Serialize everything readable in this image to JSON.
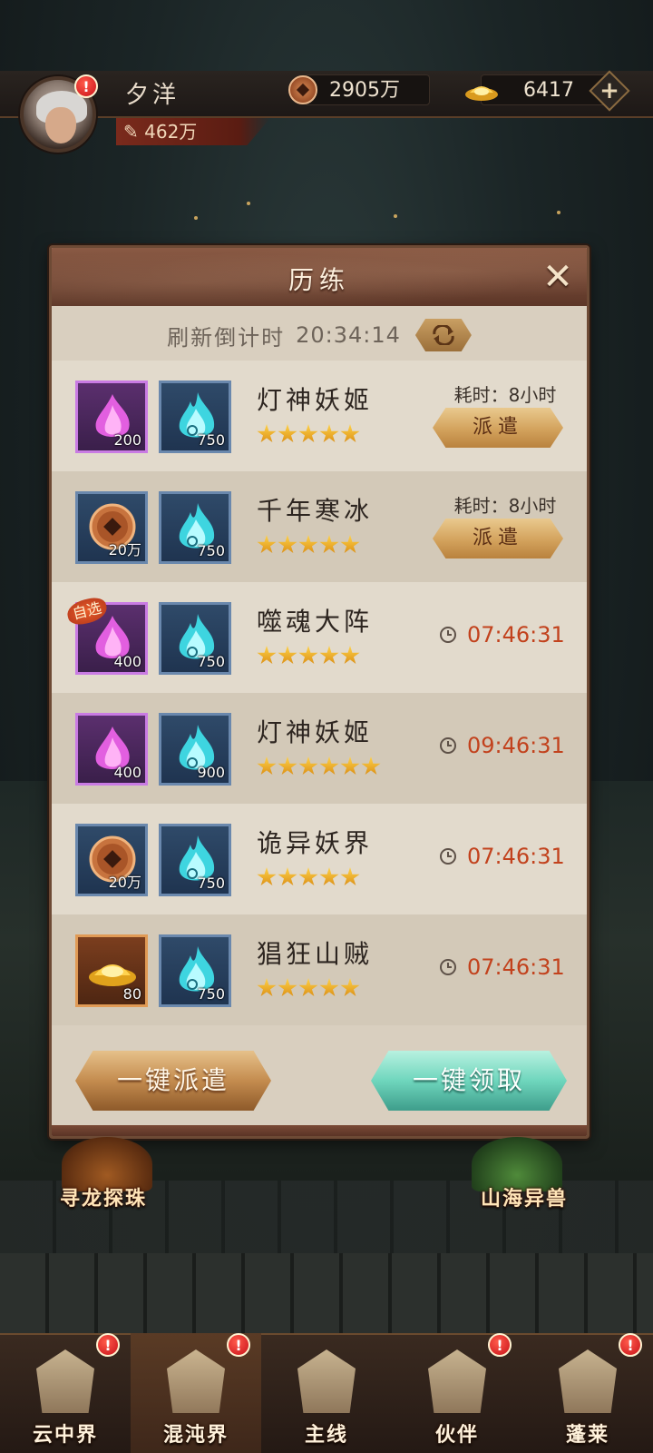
{
  "player": {
    "name": "夕洋",
    "power": "462万"
  },
  "resources": {
    "copper": "2905万",
    "gold": "6417"
  },
  "panel": {
    "title": "历练",
    "refresh_label": "刷新倒计时",
    "refresh_time": "20:34:14",
    "rows": [
      {
        "name": "灯神妖姬",
        "stars": 5,
        "item1": {
          "type": "purple-crystal",
          "qty": "200",
          "custom": false
        },
        "item2": {
          "type": "blue-flame",
          "qty": "750"
        },
        "duration": "耗时：8小时",
        "action": "派遣"
      },
      {
        "name": "千年寒冰",
        "stars": 5,
        "item1": {
          "type": "copper-coin",
          "qty": "20万",
          "custom": false
        },
        "item2": {
          "type": "blue-flame",
          "qty": "750"
        },
        "duration": "耗时：8小时",
        "action": "派遣"
      },
      {
        "name": "噬魂大阵",
        "stars": 5,
        "item1": {
          "type": "purple-crystal",
          "qty": "400",
          "custom": true
        },
        "item2": {
          "type": "blue-flame",
          "qty": "750"
        },
        "timer": "07:46:31"
      },
      {
        "name": "灯神妖姬",
        "stars": 6,
        "item1": {
          "type": "purple-crystal",
          "qty": "400",
          "custom": false
        },
        "item2": {
          "type": "blue-flame",
          "qty": "900"
        },
        "timer": "09:46:31"
      },
      {
        "name": "诡异妖界",
        "stars": 5,
        "item1": {
          "type": "copper-coin",
          "qty": "20万",
          "custom": false
        },
        "item2": {
          "type": "blue-flame",
          "qty": "750"
        },
        "timer": "07:46:31"
      },
      {
        "name": "猖狂山贼",
        "stars": 5,
        "item1": {
          "type": "gold-ingot",
          "qty": "80",
          "custom": false
        },
        "item2": {
          "type": "blue-flame",
          "qty": "750"
        },
        "timer": "07:46:31"
      }
    ],
    "custom_tag": "自选",
    "dispatch_all": "一键派遣",
    "claim_all": "一键领取"
  },
  "side_labels": {
    "left": "寻龙探珠",
    "right": "山海异兽"
  },
  "nav": [
    {
      "label": "云中界",
      "badge": "!",
      "active": false
    },
    {
      "label": "混沌界",
      "badge": "!",
      "active": true
    },
    {
      "label": "主线",
      "badge": "",
      "active": false
    },
    {
      "label": "伙伴",
      "badge": "!",
      "active": false
    },
    {
      "label": "蓬莱",
      "badge": "!",
      "active": false
    }
  ],
  "avatar_badge": "!"
}
